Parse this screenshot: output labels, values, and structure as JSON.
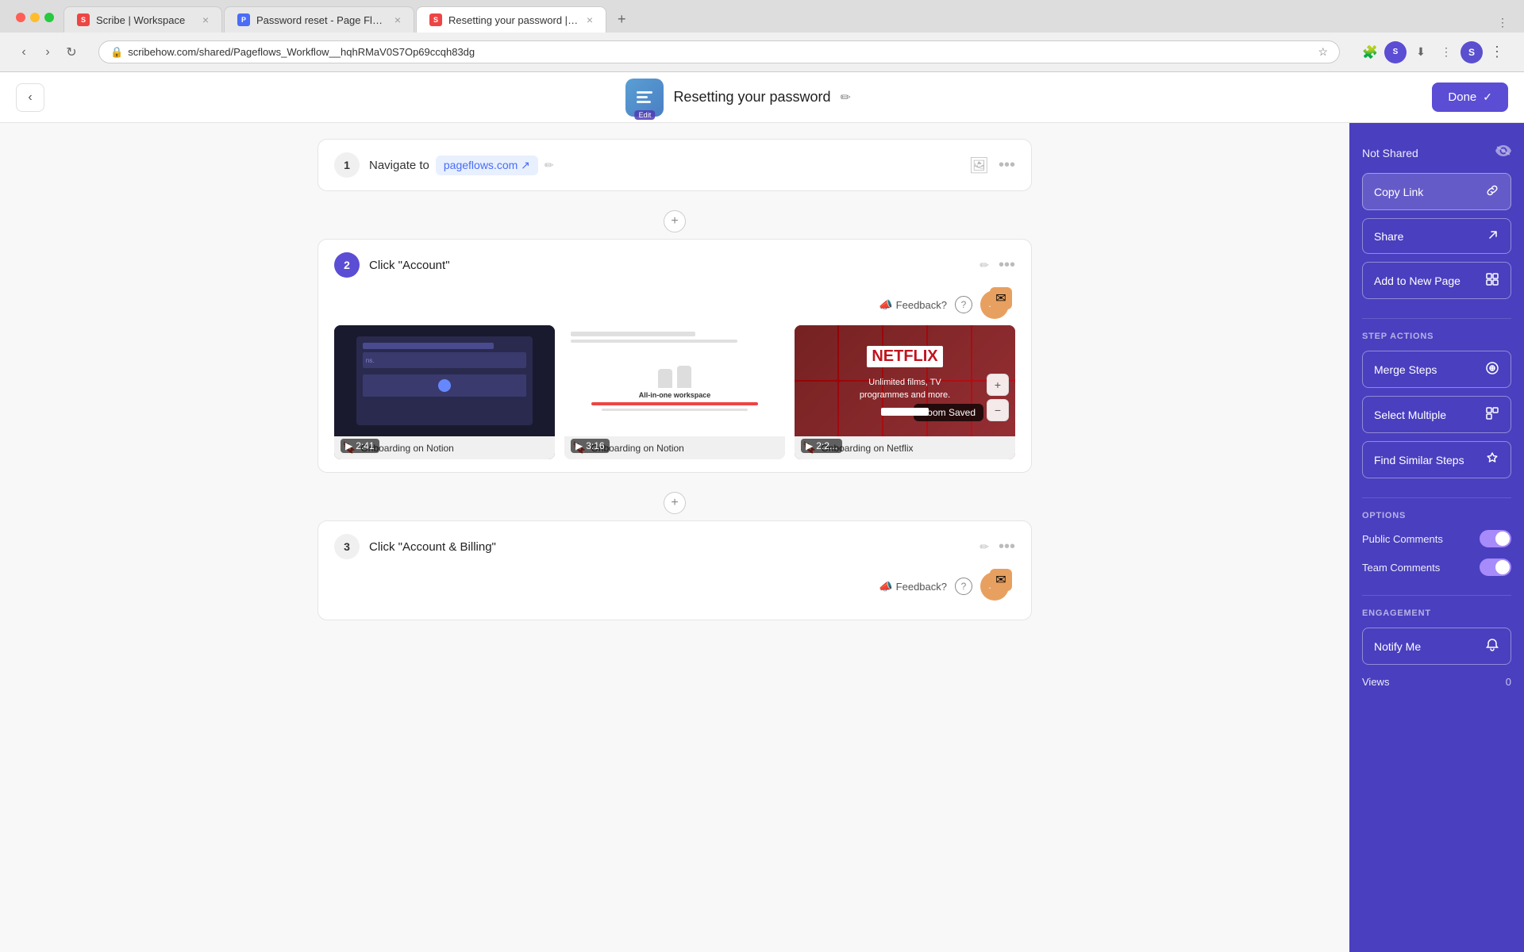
{
  "browser": {
    "tabs": [
      {
        "id": "tab1",
        "favicon_color": "#e44",
        "title": "Scribe | Workspace",
        "active": false
      },
      {
        "id": "tab2",
        "favicon_color": "#4a6cf7",
        "title": "Password reset - Page Flows",
        "active": false
      },
      {
        "id": "tab3",
        "favicon_color": "#e44",
        "title": "Resetting your password | Scri...",
        "active": true
      }
    ],
    "url": "scribehow.com/shared/Pageflows_Workflow__hqhRMaV0S7Op69ccqh83dg",
    "nav_back": "‹",
    "nav_forward": "›",
    "nav_refresh": "↻"
  },
  "header": {
    "back_label": "‹",
    "title": "Resetting your password",
    "edit_icon": "✏",
    "done_label": "Done",
    "done_check": "✓",
    "scribe_edit_label": "Edit"
  },
  "steps": [
    {
      "num": "1",
      "title": "Navigate to",
      "link_text": "pageflows.com ↗",
      "edit_icon": "✏"
    },
    {
      "num": "2",
      "title": "Click \"Account\"",
      "edit_icon": "✏",
      "feedback_text": "Feedback?",
      "videos": [
        {
          "title": "Onboarding on Notion",
          "duration": "2:41",
          "type": "notion_dark"
        },
        {
          "title": "Onboarding on Notion",
          "duration": "3:16",
          "type": "notion_white"
        },
        {
          "title": "Onboarding on Netflix",
          "duration": "2:2...",
          "type": "netflix"
        }
      ],
      "zoom_saved_label": "Zoom Saved"
    },
    {
      "num": "3",
      "title": "Click \"Account & Billing\"",
      "edit_icon": "✏",
      "feedback_text": "Feedback?"
    }
  ],
  "sidebar": {
    "not_shared_label": "Not Shared",
    "not_shared_icon": "👁",
    "copy_link_label": "Copy Link",
    "copy_link_icon": "🔗",
    "share_label": "Share",
    "share_icon": "↗",
    "add_to_new_page_label": "Add to New Page",
    "add_to_new_page_icon": "⊞",
    "step_actions_title": "STEP ACTIONS",
    "merge_steps_label": "Merge Steps",
    "merge_steps_icon": "⊕",
    "select_multiple_label": "Select Multiple",
    "select_multiple_icon": "⊟",
    "find_similar_label": "Find Similar Steps",
    "find_similar_icon": "★",
    "options_title": "OPTIONS",
    "public_comments_label": "Public Comments",
    "public_comments_on": true,
    "team_comments_label": "Team Comments",
    "team_comments_on": true,
    "engagement_title": "ENGAGEMENT",
    "notify_me_label": "Notify Me",
    "notify_icon": "🔔",
    "views_label": "Views",
    "views_count": "0"
  },
  "add_step_icon": "+",
  "workspace_label": "Scribe Workspace"
}
